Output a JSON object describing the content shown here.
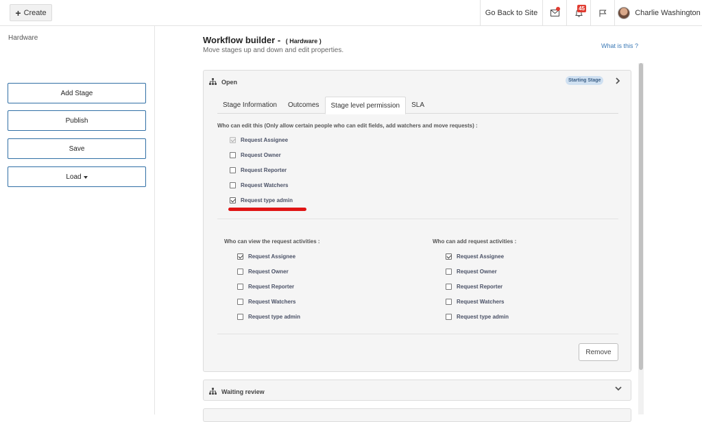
{
  "topbar": {
    "create_label": "Create",
    "go_back_label": "Go Back to Site",
    "notification_count": "45",
    "user_name": "Charlie Washington"
  },
  "sidebar": {
    "title": "Hardware",
    "buttons": [
      "Add Stage",
      "Publish",
      "Save",
      "Load"
    ]
  },
  "header": {
    "title": "Workflow builder -",
    "subtitle": "( Hardware )",
    "description": "Move stages up and down and edit properties.",
    "help_link": "What is this ?"
  },
  "stage": {
    "name": "Open",
    "badge": "Starting Stage",
    "tabs": [
      "Stage Information",
      "Outcomes",
      "Stage level permission",
      "SLA"
    ],
    "active_tab": "Stage level permission",
    "edit_label": "Who can edit this (Only allow certain people who can edit fields, add watchers and move requests) :",
    "edit_options": [
      {
        "label": "Request Assignee",
        "checked": true,
        "disabled": true
      },
      {
        "label": "Request Owner",
        "checked": false,
        "disabled": false
      },
      {
        "label": "Request Reporter",
        "checked": false,
        "disabled": false
      },
      {
        "label": "Request Watchers",
        "checked": false,
        "disabled": false
      },
      {
        "label": "Request type admin",
        "checked": true,
        "disabled": false
      }
    ],
    "view_label": "Who can view the request activities :",
    "view_options": [
      {
        "label": "Request Assignee",
        "checked": true
      },
      {
        "label": "Request Owner",
        "checked": false
      },
      {
        "label": "Request Reporter",
        "checked": false
      },
      {
        "label": "Request Watchers",
        "checked": false
      },
      {
        "label": "Request type admin",
        "checked": false
      }
    ],
    "add_label": "Who can add request activities :",
    "add_options": [
      {
        "label": "Request Assignee",
        "checked": true
      },
      {
        "label": "Request Owner",
        "checked": false
      },
      {
        "label": "Request Reporter",
        "checked": false
      },
      {
        "label": "Request Watchers",
        "checked": false
      },
      {
        "label": "Request type admin",
        "checked": false
      }
    ],
    "remove_label": "Remove"
  },
  "next_stage": {
    "name": "Waiting review"
  },
  "colors": {
    "accent_border": "#2e6da4",
    "badge_bg": "#cfe0f1",
    "notification_red": "#e03c31",
    "highlight_red": "#e01414"
  }
}
